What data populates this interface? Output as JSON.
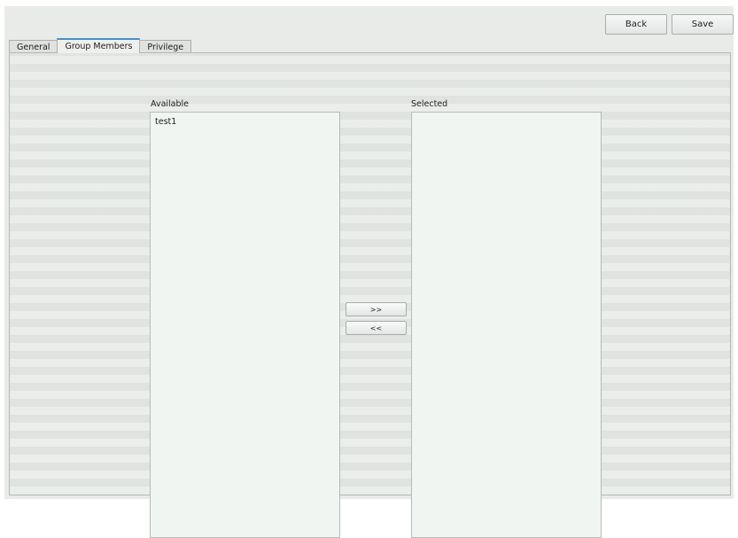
{
  "toolbar": {
    "back_label": "Back",
    "save_label": "Save"
  },
  "tabs": [
    {
      "label": "General",
      "active": false
    },
    {
      "label": "Group Members",
      "active": true
    },
    {
      "label": "Privilege",
      "active": false
    }
  ],
  "members": {
    "available_label": "Available",
    "selected_label": "Selected",
    "available_items": [
      "test1"
    ],
    "selected_items": [],
    "add_label": ">>",
    "remove_label": "<<"
  },
  "colors": {
    "active_tab_accent": "#4a8ec9",
    "panel_background": "#e4e7e4",
    "list_background": "#f1f5f1"
  }
}
